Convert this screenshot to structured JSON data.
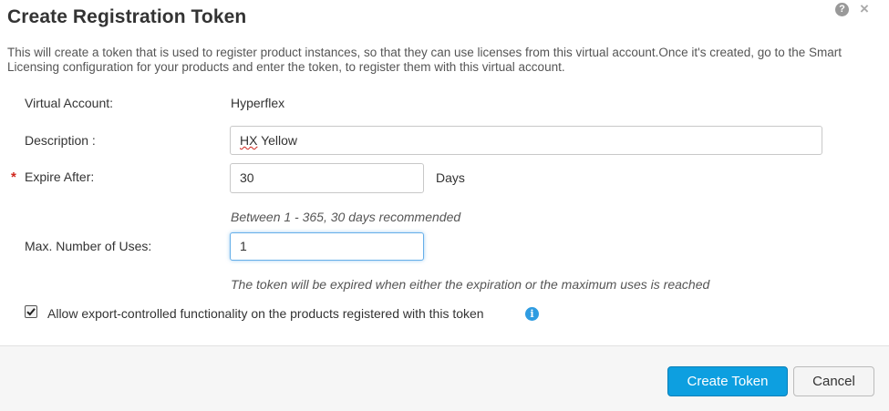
{
  "dialog": {
    "title": "Create Registration Token",
    "help_icon": "?",
    "close_icon": "×",
    "description": "This will create a token that is used to register product instances, so that they can use licenses from this virtual account.Once it's created, go to the Smart Licensing configuration for your products and enter the token, to register them with this virtual account."
  },
  "form": {
    "virtual_account": {
      "label": "Virtual Account:",
      "value": "Hyperflex"
    },
    "description": {
      "label": "Description :",
      "value_prefix": "HX",
      "value_suffix": " Yellow"
    },
    "expire_after": {
      "required_marker": "*",
      "label": "Expire After:",
      "value": "30",
      "unit": "Days",
      "hint": "Between 1 - 365, 30 days recommended"
    },
    "max_uses": {
      "label": "Max. Number of Uses:",
      "value": "1",
      "hint": "The token will be expired when either the expiration or the maximum uses is reached"
    },
    "export_controlled": {
      "checked": true,
      "label": "Allow export-controlled functionality on the products registered with this token",
      "info_icon": "i"
    }
  },
  "footer": {
    "create_label": "Create Token",
    "cancel_label": "Cancel"
  },
  "colors": {
    "primary_button": "#0d9fe0",
    "required": "#d0271d",
    "info": "#2f9ce1"
  },
  "icons": {
    "help": "question-circle-icon",
    "close": "close-icon",
    "info": "info-circle-icon",
    "checkbox": "checkmark-icon"
  }
}
